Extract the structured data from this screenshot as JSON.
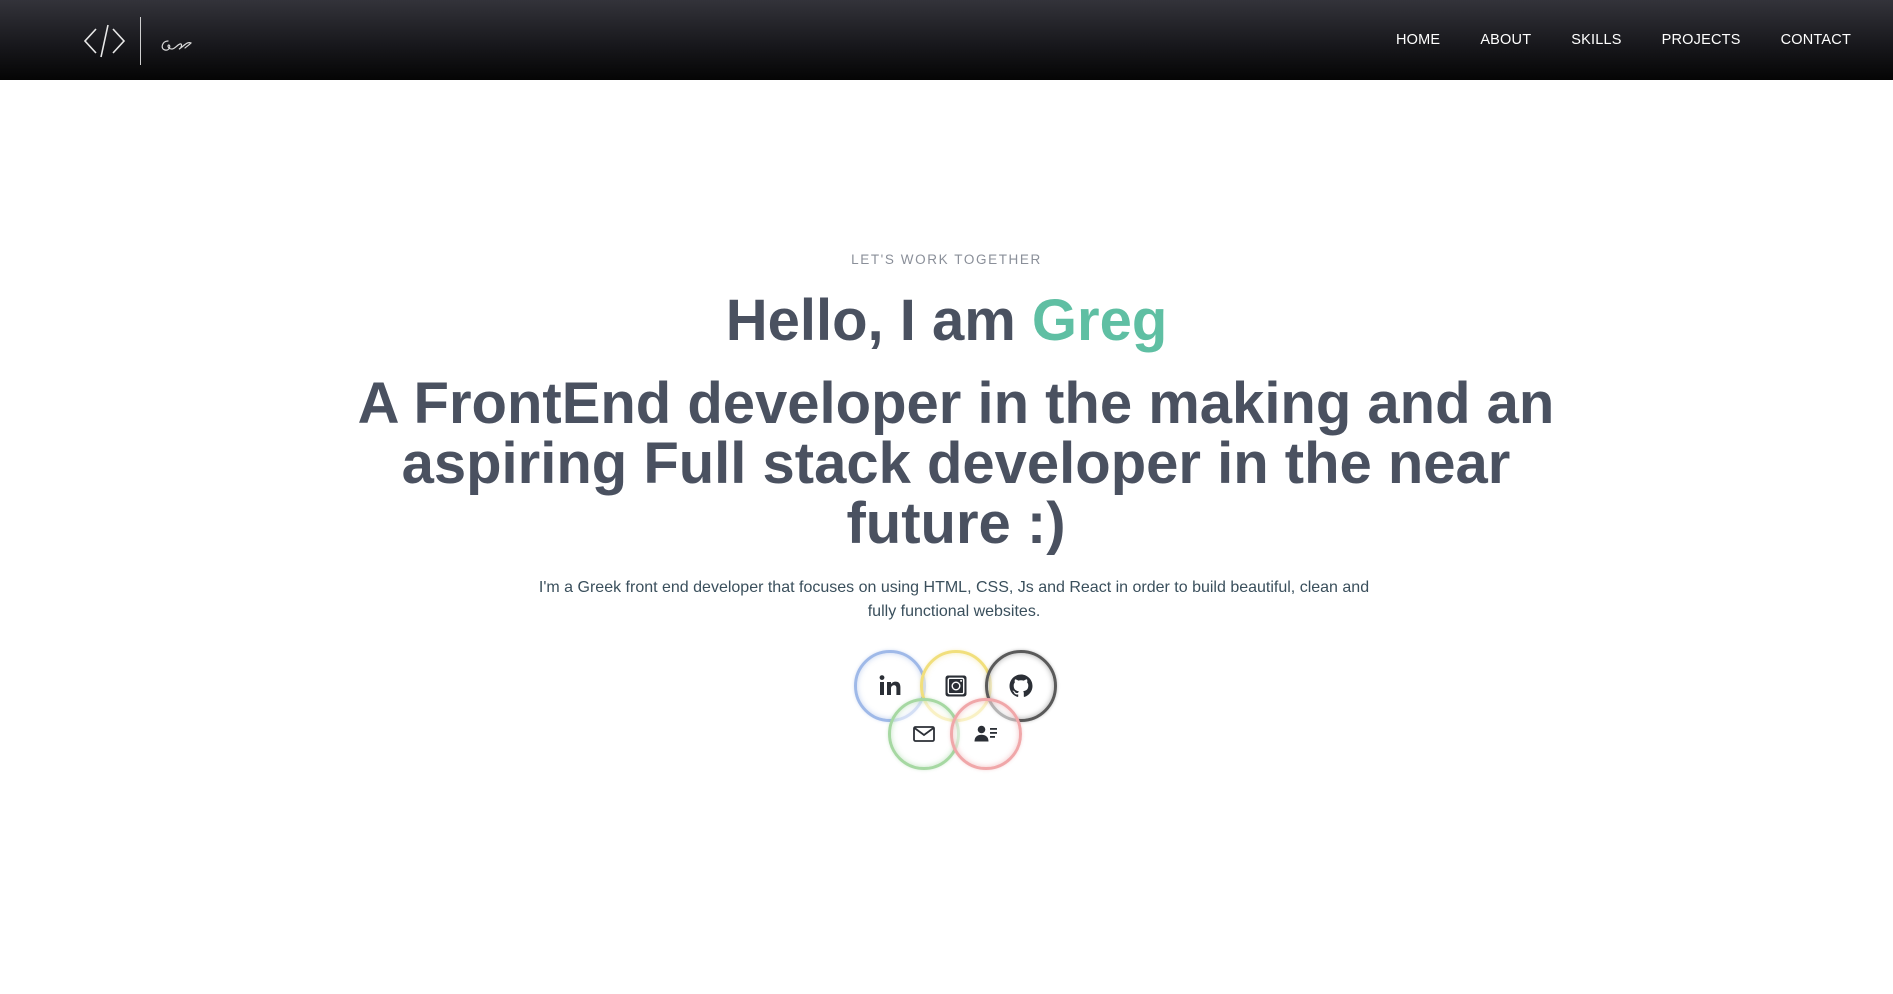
{
  "navbar": {
    "logo_icon": "code-brackets-icon",
    "signature_icon": "signature-icon",
    "links": [
      {
        "label": "HOME"
      },
      {
        "label": "ABOUT"
      },
      {
        "label": "SKILLS"
      },
      {
        "label": "PROJECTS"
      },
      {
        "label": "CONTACT"
      }
    ]
  },
  "hero": {
    "eyebrow": "LET'S WORK TOGETHER",
    "greeting": "Hello, I am ",
    "name": "Greg",
    "headline": "A FrontEnd developer in the making and an aspiring Full stack developer in the near future :)",
    "description": "I'm a Greek front end developer that focuses on using HTML, CSS, Js and React in order to build beautiful, clean and fully functional websites."
  },
  "socials": [
    {
      "icon": "linkedin-icon",
      "ring_color": "#9fb9e8"
    },
    {
      "icon": "instagram-icon",
      "ring_color": "#f1df7c"
    },
    {
      "icon": "github-icon",
      "ring_color": "#5a5a5a"
    },
    {
      "icon": "mail-icon",
      "ring_color": "#a6d8a2"
    },
    {
      "icon": "contact-card-icon",
      "ring_color": "#f0a7a9"
    }
  ],
  "colors": {
    "accent": "#5fbfa3",
    "heading": "#4a5160",
    "navbar": "#16161a"
  }
}
